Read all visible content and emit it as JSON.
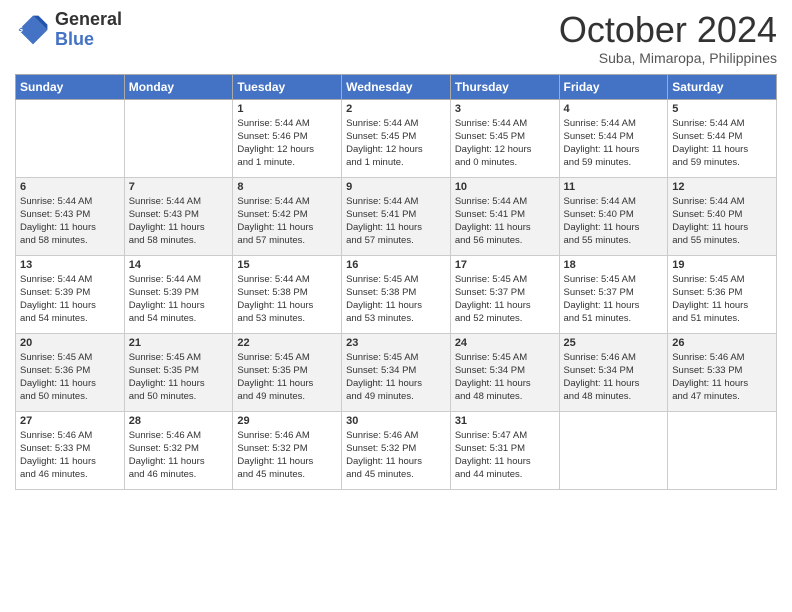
{
  "header": {
    "logo_line1": "General",
    "logo_line2": "Blue",
    "month_title": "October 2024",
    "subtitle": "Suba, Mimaropa, Philippines"
  },
  "weekdays": [
    "Sunday",
    "Monday",
    "Tuesday",
    "Wednesday",
    "Thursday",
    "Friday",
    "Saturday"
  ],
  "weeks": [
    [
      {
        "day": "",
        "info": ""
      },
      {
        "day": "",
        "info": ""
      },
      {
        "day": "1",
        "info": "Sunrise: 5:44 AM\nSunset: 5:46 PM\nDaylight: 12 hours\nand 1 minute."
      },
      {
        "day": "2",
        "info": "Sunrise: 5:44 AM\nSunset: 5:45 PM\nDaylight: 12 hours\nand 1 minute."
      },
      {
        "day": "3",
        "info": "Sunrise: 5:44 AM\nSunset: 5:45 PM\nDaylight: 12 hours\nand 0 minutes."
      },
      {
        "day": "4",
        "info": "Sunrise: 5:44 AM\nSunset: 5:44 PM\nDaylight: 11 hours\nand 59 minutes."
      },
      {
        "day": "5",
        "info": "Sunrise: 5:44 AM\nSunset: 5:44 PM\nDaylight: 11 hours\nand 59 minutes."
      }
    ],
    [
      {
        "day": "6",
        "info": "Sunrise: 5:44 AM\nSunset: 5:43 PM\nDaylight: 11 hours\nand 58 minutes."
      },
      {
        "day": "7",
        "info": "Sunrise: 5:44 AM\nSunset: 5:43 PM\nDaylight: 11 hours\nand 58 minutes."
      },
      {
        "day": "8",
        "info": "Sunrise: 5:44 AM\nSunset: 5:42 PM\nDaylight: 11 hours\nand 57 minutes."
      },
      {
        "day": "9",
        "info": "Sunrise: 5:44 AM\nSunset: 5:41 PM\nDaylight: 11 hours\nand 57 minutes."
      },
      {
        "day": "10",
        "info": "Sunrise: 5:44 AM\nSunset: 5:41 PM\nDaylight: 11 hours\nand 56 minutes."
      },
      {
        "day": "11",
        "info": "Sunrise: 5:44 AM\nSunset: 5:40 PM\nDaylight: 11 hours\nand 55 minutes."
      },
      {
        "day": "12",
        "info": "Sunrise: 5:44 AM\nSunset: 5:40 PM\nDaylight: 11 hours\nand 55 minutes."
      }
    ],
    [
      {
        "day": "13",
        "info": "Sunrise: 5:44 AM\nSunset: 5:39 PM\nDaylight: 11 hours\nand 54 minutes."
      },
      {
        "day": "14",
        "info": "Sunrise: 5:44 AM\nSunset: 5:39 PM\nDaylight: 11 hours\nand 54 minutes."
      },
      {
        "day": "15",
        "info": "Sunrise: 5:44 AM\nSunset: 5:38 PM\nDaylight: 11 hours\nand 53 minutes."
      },
      {
        "day": "16",
        "info": "Sunrise: 5:45 AM\nSunset: 5:38 PM\nDaylight: 11 hours\nand 53 minutes."
      },
      {
        "day": "17",
        "info": "Sunrise: 5:45 AM\nSunset: 5:37 PM\nDaylight: 11 hours\nand 52 minutes."
      },
      {
        "day": "18",
        "info": "Sunrise: 5:45 AM\nSunset: 5:37 PM\nDaylight: 11 hours\nand 51 minutes."
      },
      {
        "day": "19",
        "info": "Sunrise: 5:45 AM\nSunset: 5:36 PM\nDaylight: 11 hours\nand 51 minutes."
      }
    ],
    [
      {
        "day": "20",
        "info": "Sunrise: 5:45 AM\nSunset: 5:36 PM\nDaylight: 11 hours\nand 50 minutes."
      },
      {
        "day": "21",
        "info": "Sunrise: 5:45 AM\nSunset: 5:35 PM\nDaylight: 11 hours\nand 50 minutes."
      },
      {
        "day": "22",
        "info": "Sunrise: 5:45 AM\nSunset: 5:35 PM\nDaylight: 11 hours\nand 49 minutes."
      },
      {
        "day": "23",
        "info": "Sunrise: 5:45 AM\nSunset: 5:34 PM\nDaylight: 11 hours\nand 49 minutes."
      },
      {
        "day": "24",
        "info": "Sunrise: 5:45 AM\nSunset: 5:34 PM\nDaylight: 11 hours\nand 48 minutes."
      },
      {
        "day": "25",
        "info": "Sunrise: 5:46 AM\nSunset: 5:34 PM\nDaylight: 11 hours\nand 48 minutes."
      },
      {
        "day": "26",
        "info": "Sunrise: 5:46 AM\nSunset: 5:33 PM\nDaylight: 11 hours\nand 47 minutes."
      }
    ],
    [
      {
        "day": "27",
        "info": "Sunrise: 5:46 AM\nSunset: 5:33 PM\nDaylight: 11 hours\nand 46 minutes."
      },
      {
        "day": "28",
        "info": "Sunrise: 5:46 AM\nSunset: 5:32 PM\nDaylight: 11 hours\nand 46 minutes."
      },
      {
        "day": "29",
        "info": "Sunrise: 5:46 AM\nSunset: 5:32 PM\nDaylight: 11 hours\nand 45 minutes."
      },
      {
        "day": "30",
        "info": "Sunrise: 5:46 AM\nSunset: 5:32 PM\nDaylight: 11 hours\nand 45 minutes."
      },
      {
        "day": "31",
        "info": "Sunrise: 5:47 AM\nSunset: 5:31 PM\nDaylight: 11 hours\nand 44 minutes."
      },
      {
        "day": "",
        "info": ""
      },
      {
        "day": "",
        "info": ""
      }
    ]
  ]
}
